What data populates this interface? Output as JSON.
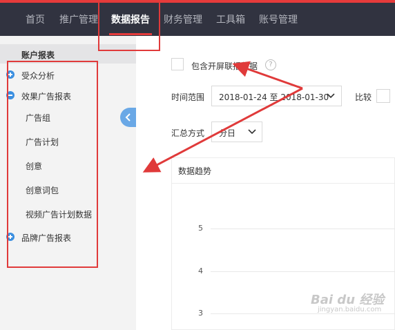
{
  "nav": {
    "items": [
      {
        "label": "首页"
      },
      {
        "label": "推广管理"
      },
      {
        "label": "数据报告"
      },
      {
        "label": "财务管理"
      },
      {
        "label": "工具箱"
      },
      {
        "label": "账号管理"
      }
    ],
    "active_index": 2
  },
  "sidebar": {
    "header": "账户报表",
    "items": [
      {
        "label": "受众分析",
        "icon": "plus-circle-icon"
      },
      {
        "label": "效果广告报表",
        "icon": "minus-circle-icon"
      },
      {
        "label": "广告组"
      },
      {
        "label": "广告计划"
      },
      {
        "label": "创意"
      },
      {
        "label": "创意词包"
      },
      {
        "label": "视频广告计划数据"
      },
      {
        "label": "品牌广告报表",
        "icon": "plus-circle-icon"
      }
    ]
  },
  "filters": {
    "include_splash_label": "包含开屏联播数据",
    "help_mark": "?",
    "time_range_label": "时间范围",
    "time_range_value": "2018-01-24 至 2018-01-30",
    "compare_label": "比较",
    "aggregate_label": "汇总方式",
    "aggregate_value": "分日"
  },
  "chart": {
    "title": "数据趋势",
    "y_ticks": [
      "5",
      "4",
      "3"
    ]
  },
  "chart_data": {
    "type": "line",
    "title": "数据趋势",
    "y_ticks": [
      5,
      4,
      3
    ],
    "series": []
  },
  "watermark": {
    "text": "Bai du 经验",
    "sub": "jingyan.baidu.com"
  },
  "colors": {
    "topbar": "#313340",
    "accent_red": "#e63b3b",
    "accent_blue": "#3b8fe0"
  }
}
